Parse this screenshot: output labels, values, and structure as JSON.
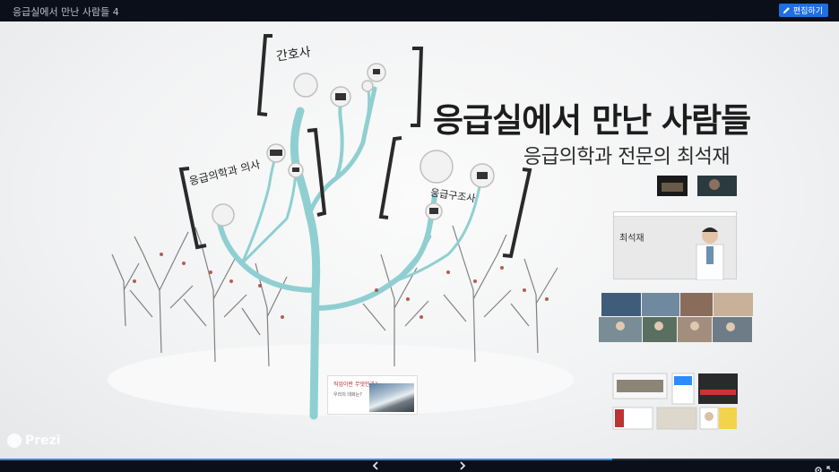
{
  "topbar": {
    "title": "응급실에서 만난 사람들 4",
    "edit_label": "편집하기"
  },
  "slide": {
    "title": "응급실에서 만난 사람들",
    "subtitle": "응급의학과 전문의 최석재",
    "branch_nurse": "간호사",
    "branch_doctor": "응급의학과 의사",
    "branch_paramedic": "응급구조사",
    "profile_name": "최석재",
    "lecture_title": "직업이란 무엇인가?",
    "lecture_question": "우리의 대화는?"
  },
  "brand": {
    "name": "Prezi"
  },
  "progress": {
    "fraction": 0.73
  },
  "nav": {
    "prev_icon": "chevron-left-icon",
    "next_icon": "chevron-right-icon"
  },
  "colors": {
    "accent": "#1f6fe0",
    "tree": "#8fcfd2",
    "bracket": "#2a2a2a"
  }
}
